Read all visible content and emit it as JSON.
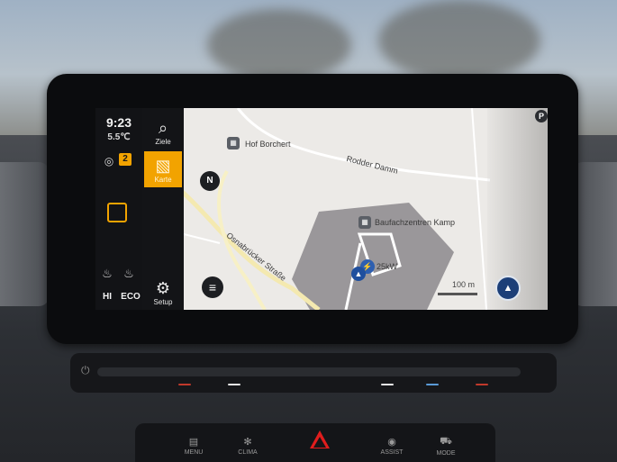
{
  "status": {
    "time": "9:23",
    "temperature": "5.5℃",
    "speed_limit_badge": "2",
    "icons": {
      "lane_assist": "lane-assist-icon",
      "ambient_square": "square-outline-icon",
      "seat_heat_left": "seat-heat-icon",
      "seat_heat_right": "seat-heat-icon"
    },
    "seat_left_label": "HI",
    "seat_right_label": "ECO"
  },
  "nav": {
    "items": [
      {
        "label": "Ziele",
        "icon": "search-icon"
      },
      {
        "label": "Karte",
        "icon": "map-icon"
      },
      {
        "label": "Setup",
        "icon": "gear-icon"
      }
    ],
    "active_color": "#f2a300"
  },
  "map": {
    "compass": "N",
    "labels": {
      "poi_1": "Hof Borchert",
      "street_1": "Rodder Damm",
      "poi_2": "Baufachzentren Kamp",
      "street_2": "Osnabrücker Straße",
      "charging": "25kW"
    },
    "scale": "100 m",
    "parking": "P"
  },
  "console": {
    "buttons": [
      {
        "label": "MENU",
        "icon": "menu-icon"
      },
      {
        "label": "CLIMA",
        "icon": "fan-icon"
      },
      {
        "label": "ASSIST",
        "icon": "assist-icon"
      },
      {
        "label": "MODE",
        "icon": "car-icon"
      }
    ],
    "hazard_color": "#e01d1d"
  }
}
